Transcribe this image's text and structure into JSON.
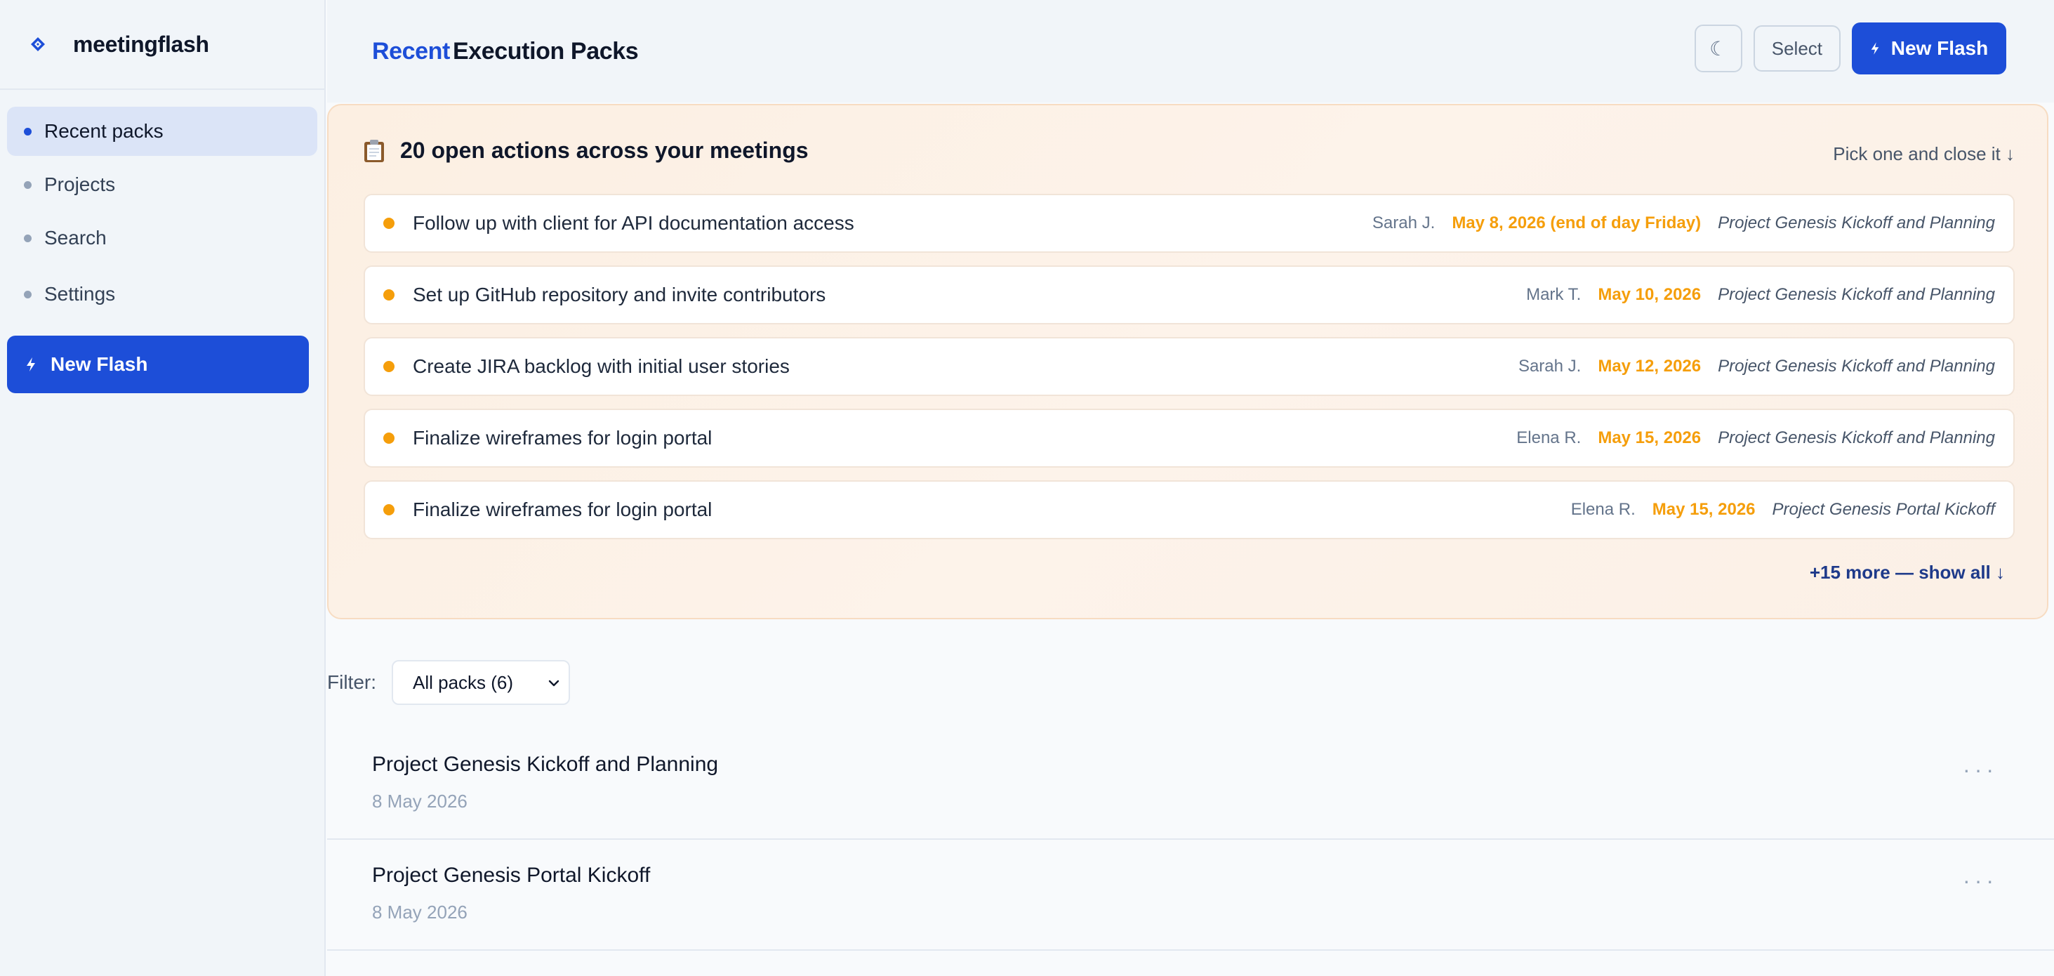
{
  "app": {
    "name": "meetingflash",
    "logo_icon": "diamond-logo-icon",
    "accent_color": "#1d4ed8"
  },
  "sidebar": {
    "items": [
      {
        "label": "Recent packs",
        "active": true
      },
      {
        "label": "Projects",
        "active": false
      },
      {
        "label": "Search",
        "active": false
      },
      {
        "label": "Settings",
        "active": false
      }
    ],
    "cta_label": "New Flash",
    "cta_icon": "bolt-icon"
  },
  "header": {
    "title_accent": "Recent",
    "title_rest": "Execution Packs",
    "theme_toggle_icon": "☾",
    "select_label": "Select",
    "new_flash_label": "New Flash"
  },
  "actions": {
    "icon": "clipboard-icon",
    "heading": "20 open actions across your meetings",
    "hint": "Pick one and close it ↓",
    "items": [
      {
        "title": "Follow up with client for API documentation access",
        "owner": "Sarah J.",
        "due": "May 8, 2026 (end of day Friday)",
        "project": "Project Genesis Kickoff and Planning"
      },
      {
        "title": "Set up GitHub repository and invite contributors",
        "owner": "Mark T.",
        "due": "May 10, 2026",
        "project": "Project Genesis Kickoff and Planning"
      },
      {
        "title": "Create JIRA backlog with initial user stories",
        "owner": "Sarah J.",
        "due": "May 12, 2026",
        "project": "Project Genesis Kickoff and Planning"
      },
      {
        "title": "Finalize wireframes for login portal",
        "owner": "Elena R.",
        "due": "May 15, 2026",
        "project": "Project Genesis Kickoff and Planning"
      },
      {
        "title": "Finalize wireframes for login portal",
        "owner": "Elena R.",
        "due": "May 15, 2026",
        "project": "Project Genesis Portal Kickoff"
      }
    ],
    "show_more": "+15 more — show all ↓",
    "due_color": "#f59e0b"
  },
  "filter": {
    "label": "Filter:",
    "selected": "All packs (6)"
  },
  "packs": [
    {
      "name": "Project Genesis Kickoff and Planning",
      "date": "8 May 2026",
      "menu": "···"
    },
    {
      "name": "Project Genesis Portal Kickoff",
      "date": "8 May 2026",
      "menu": "···"
    }
  ]
}
